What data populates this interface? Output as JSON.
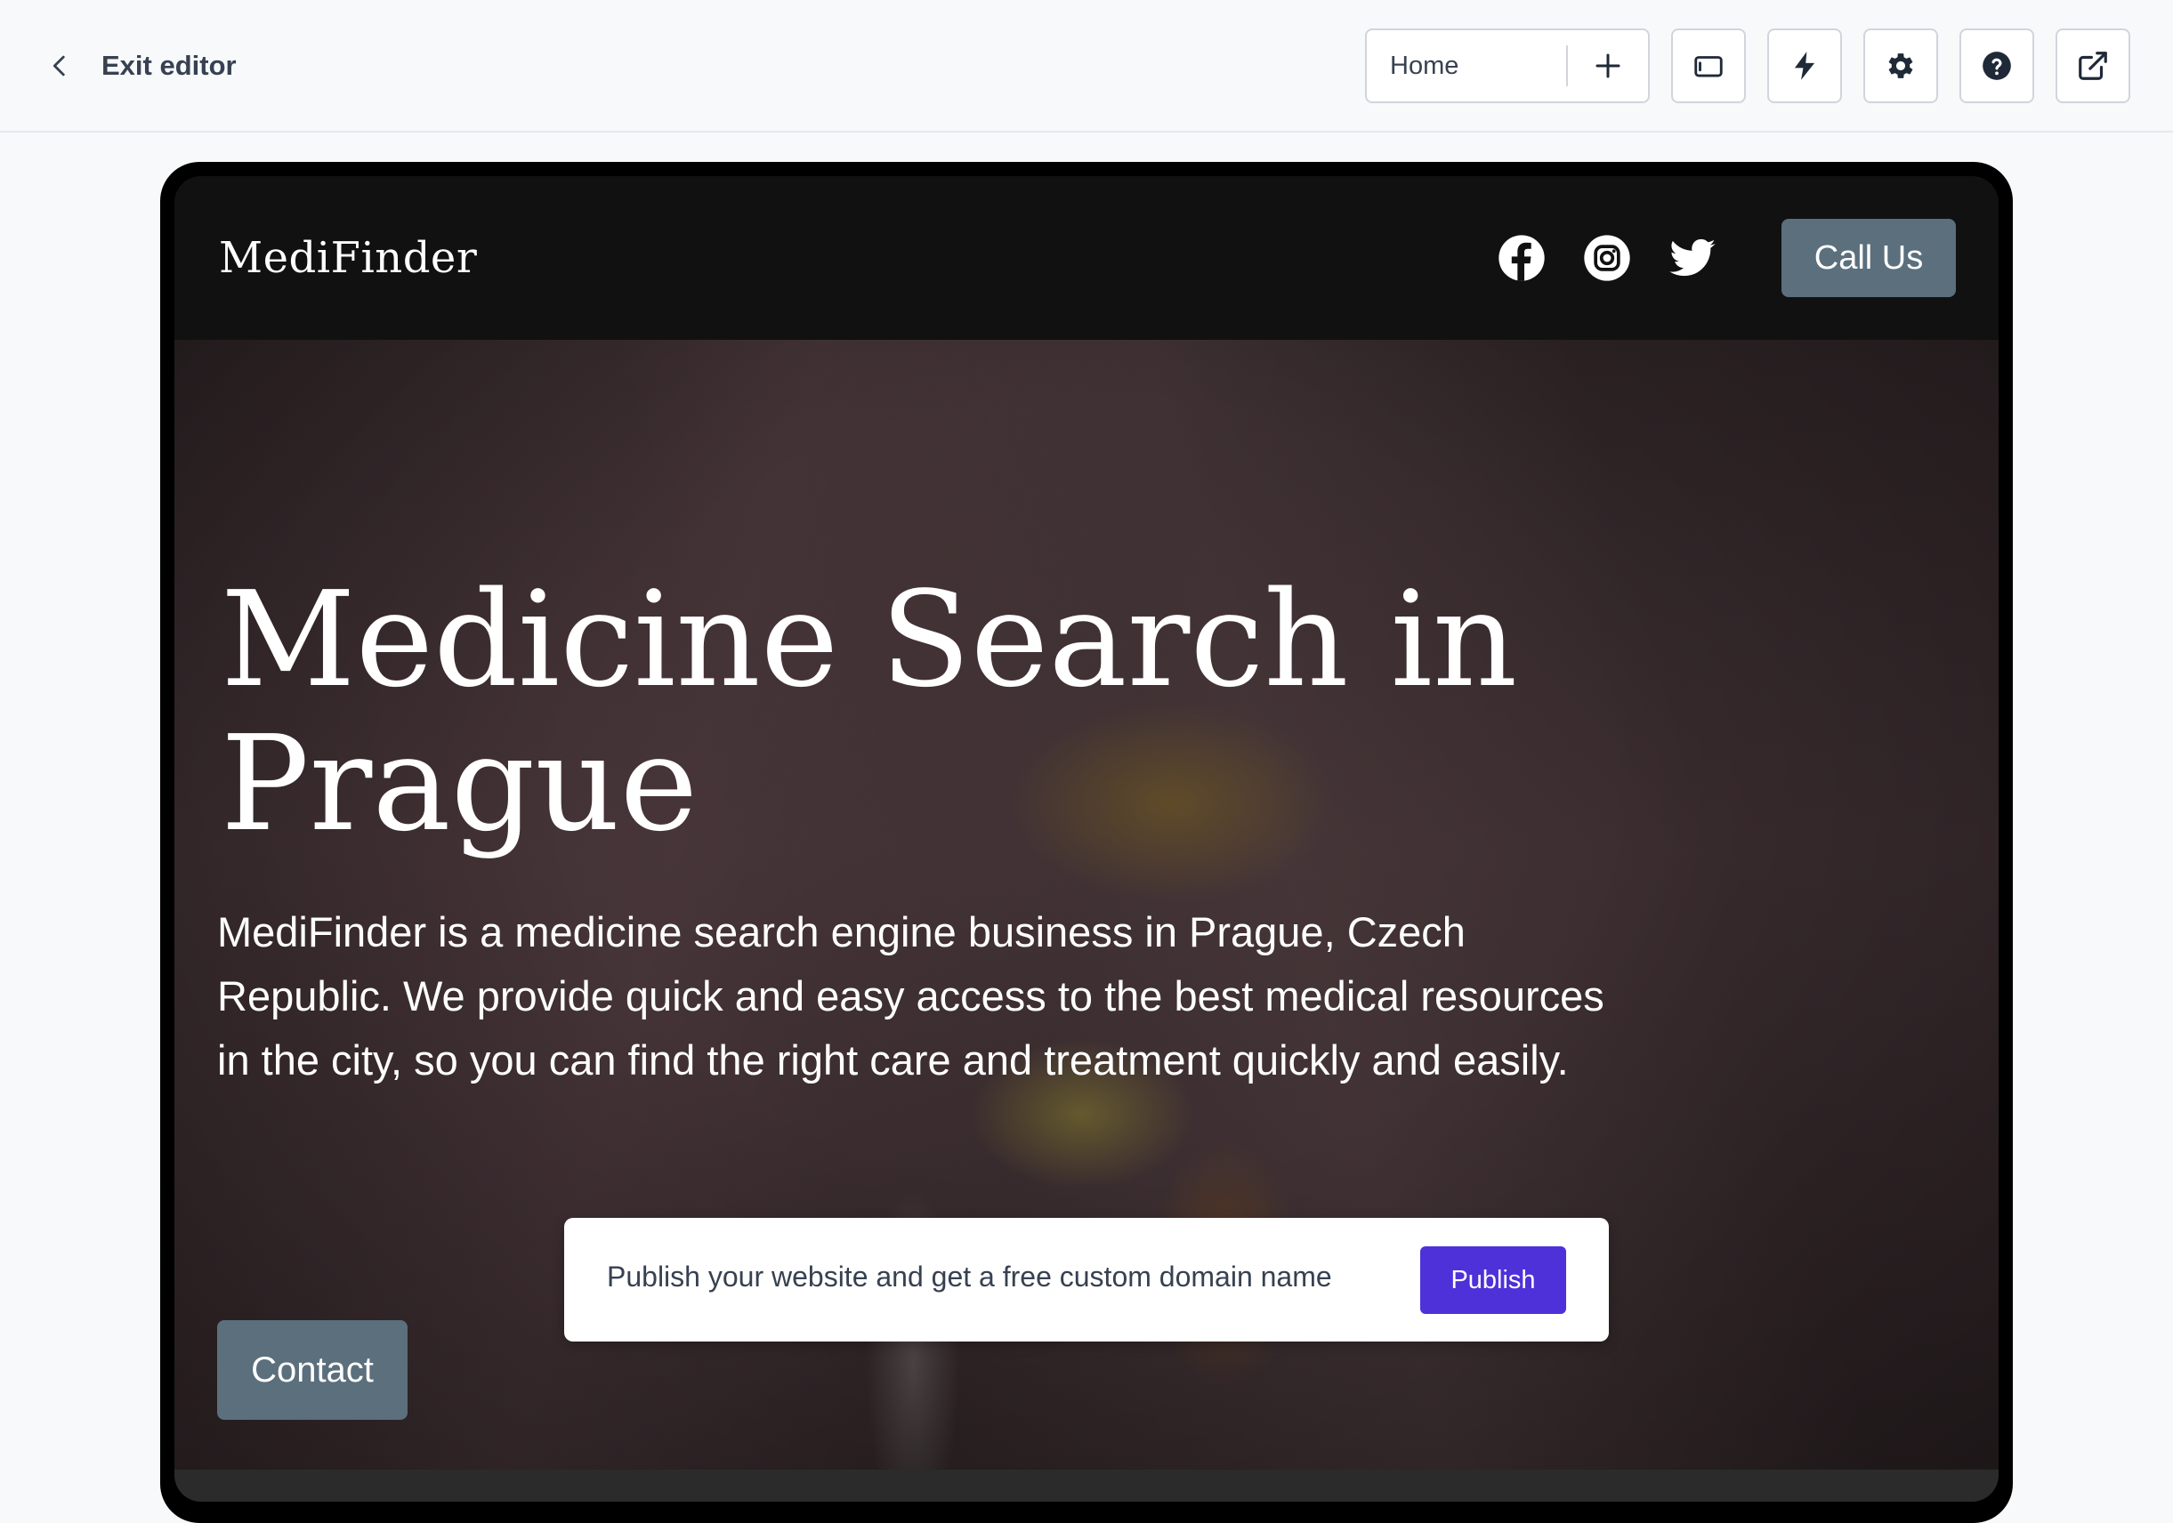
{
  "editor": {
    "exit_label": "Exit editor",
    "back_icon": "chevron-left-icon",
    "page_select": {
      "value": "Home",
      "add_icon": "plus-icon"
    },
    "tools": [
      {
        "name": "device-preview",
        "icon": "tablet-icon"
      },
      {
        "name": "quick-actions",
        "icon": "lightning-icon"
      },
      {
        "name": "settings",
        "icon": "gear-icon"
      },
      {
        "name": "help",
        "icon": "question-circle-icon"
      },
      {
        "name": "open-site",
        "icon": "external-link-icon"
      }
    ]
  },
  "site": {
    "brand": "MediFinder",
    "social": [
      "facebook-icon",
      "instagram-icon",
      "twitter-icon"
    ],
    "call_label": "Call Us",
    "hero": {
      "title": "Medicine Search in Prague",
      "description": "MediFinder is a medicine search engine business in Prague, Czech Republic. We provide quick and easy access to the best medical resources in the city, so you can find the right care and treatment quickly and easily.",
      "contact_label": "Contact"
    }
  },
  "publish_banner": {
    "text": "Publish your website and get a free custom domain name",
    "button_label": "Publish"
  },
  "colors": {
    "accent_button": "#5b6f7d",
    "publish_button": "#4f31d9",
    "nav_background": "#111111"
  }
}
